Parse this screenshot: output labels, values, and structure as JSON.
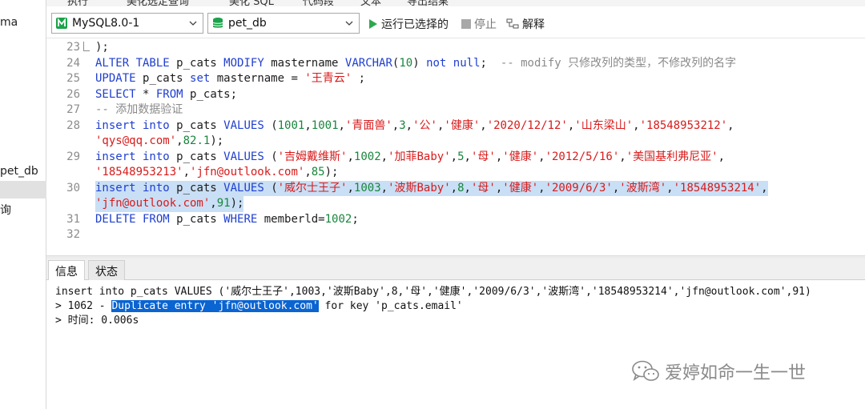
{
  "top_strip": [
    "执行",
    "美化选定查询",
    "美化 SQL",
    "代码段",
    "文本",
    "导出结果"
  ],
  "navigator": {
    "items": [
      "ma",
      "pet_db",
      "询"
    ]
  },
  "toolbar": {
    "connection": "MySQL8.0-1",
    "database": "pet_db",
    "run_selected": "运行已选择的",
    "stop": "停止",
    "explain": "解释",
    "colors": {
      "connection_icon": "#1aa34a",
      "database_icon": "#1aa34a",
      "run_icon": "#2fa84f"
    }
  },
  "editor": {
    "lines": [
      {
        "no": "23",
        "tokens": [
          {
            "t": "p",
            "v": ");"
          }
        ]
      },
      {
        "no": "24",
        "tokens": [
          {
            "t": "k",
            "v": "ALTER TABLE "
          },
          {
            "t": "p",
            "v": "p_cats "
          },
          {
            "t": "k",
            "v": "MODIFY "
          },
          {
            "t": "p",
            "v": "mastername "
          },
          {
            "t": "k",
            "v": "VARCHAR"
          },
          {
            "t": "p",
            "v": "("
          },
          {
            "t": "n",
            "v": "10"
          },
          {
            "t": "p",
            "v": ") "
          },
          {
            "t": "k",
            "v": "not null"
          },
          {
            "t": "p",
            "v": ";  "
          },
          {
            "t": "c",
            "v": "-- modify 只修改列的类型，不修改列的名字"
          }
        ]
      },
      {
        "no": "25",
        "tokens": [
          {
            "t": "k",
            "v": "UPDATE "
          },
          {
            "t": "p",
            "v": "p_cats "
          },
          {
            "t": "k",
            "v": "set "
          },
          {
            "t": "p",
            "v": "mastername = "
          },
          {
            "t": "s",
            "v": "'王青云'"
          },
          {
            "t": "p",
            "v": " ;"
          }
        ]
      },
      {
        "no": "26",
        "tokens": [
          {
            "t": "k",
            "v": "SELECT "
          },
          {
            "t": "p",
            "v": "* "
          },
          {
            "t": "k",
            "v": "FROM "
          },
          {
            "t": "p",
            "v": "p_cats;"
          }
        ]
      },
      {
        "no": "27",
        "tokens": [
          {
            "t": "c",
            "v": "-- 添加数据验证"
          }
        ]
      },
      {
        "no": "28",
        "tokens": [
          {
            "t": "k",
            "v": "insert into "
          },
          {
            "t": "p",
            "v": "p_cats "
          },
          {
            "t": "k",
            "v": "VALUES "
          },
          {
            "t": "p",
            "v": "("
          },
          {
            "t": "n",
            "v": "1001"
          },
          {
            "t": "p",
            "v": ","
          },
          {
            "t": "n",
            "v": "1001"
          },
          {
            "t": "p",
            "v": ","
          },
          {
            "t": "s",
            "v": "'青面兽'"
          },
          {
            "t": "p",
            "v": ","
          },
          {
            "t": "n",
            "v": "3"
          },
          {
            "t": "p",
            "v": ","
          },
          {
            "t": "s",
            "v": "'公'"
          },
          {
            "t": "p",
            "v": ","
          },
          {
            "t": "s",
            "v": "'健康'"
          },
          {
            "t": "p",
            "v": ","
          },
          {
            "t": "s",
            "v": "'2020/12/12'"
          },
          {
            "t": "p",
            "v": ","
          },
          {
            "t": "s",
            "v": "'山东梁山'"
          },
          {
            "t": "p",
            "v": ","
          },
          {
            "t": "s",
            "v": "'18548953212'"
          },
          {
            "t": "p",
            "v": ","
          }
        ]
      },
      {
        "no": "",
        "tokens": [
          {
            "t": "s",
            "v": "'qys@qq.com'"
          },
          {
            "t": "p",
            "v": ","
          },
          {
            "t": "n",
            "v": "82.1"
          },
          {
            "t": "p",
            "v": ");"
          }
        ]
      },
      {
        "no": "29",
        "tokens": [
          {
            "t": "k",
            "v": "insert into "
          },
          {
            "t": "p",
            "v": "p_cats "
          },
          {
            "t": "k",
            "v": "VALUES "
          },
          {
            "t": "p",
            "v": "("
          },
          {
            "t": "s",
            "v": "'吉姆戴维斯'"
          },
          {
            "t": "p",
            "v": ","
          },
          {
            "t": "n",
            "v": "1002"
          },
          {
            "t": "p",
            "v": ","
          },
          {
            "t": "s",
            "v": "'加菲Baby'"
          },
          {
            "t": "p",
            "v": ","
          },
          {
            "t": "n",
            "v": "5"
          },
          {
            "t": "p",
            "v": ","
          },
          {
            "t": "s",
            "v": "'母'"
          },
          {
            "t": "p",
            "v": ","
          },
          {
            "t": "s",
            "v": "'健康'"
          },
          {
            "t": "p",
            "v": ","
          },
          {
            "t": "s",
            "v": "'2012/5/16'"
          },
          {
            "t": "p",
            "v": ","
          },
          {
            "t": "s",
            "v": "'美国基利弗尼亚'"
          },
          {
            "t": "p",
            "v": ","
          }
        ]
      },
      {
        "no": "",
        "tokens": [
          {
            "t": "s",
            "v": "'18548953213'"
          },
          {
            "t": "p",
            "v": ","
          },
          {
            "t": "s",
            "v": "'jfn@outlook.com'"
          },
          {
            "t": "p",
            "v": ","
          },
          {
            "t": "n",
            "v": "85"
          },
          {
            "t": "p",
            "v": ");"
          }
        ]
      },
      {
        "no": "30",
        "hl": true,
        "tokens": [
          {
            "t": "k",
            "v": "insert into "
          },
          {
            "t": "p",
            "v": "p_cats "
          },
          {
            "t": "k",
            "v": "VALUES "
          },
          {
            "t": "p",
            "v": "("
          },
          {
            "t": "s",
            "v": "'威尔士王子'"
          },
          {
            "t": "p",
            "v": ","
          },
          {
            "t": "n",
            "v": "1003"
          },
          {
            "t": "p",
            "v": ","
          },
          {
            "t": "s",
            "v": "'波斯Baby'"
          },
          {
            "t": "p",
            "v": ","
          },
          {
            "t": "n",
            "v": "8"
          },
          {
            "t": "p",
            "v": ","
          },
          {
            "t": "s",
            "v": "'母'"
          },
          {
            "t": "p",
            "v": ","
          },
          {
            "t": "s",
            "v": "'健康'"
          },
          {
            "t": "p",
            "v": ","
          },
          {
            "t": "s",
            "v": "'2009/6/3'"
          },
          {
            "t": "p",
            "v": ","
          },
          {
            "t": "s",
            "v": "'波斯湾'"
          },
          {
            "t": "p",
            "v": ","
          },
          {
            "t": "s",
            "v": "'18548953214'"
          },
          {
            "t": "p",
            "v": ","
          }
        ]
      },
      {
        "no": "",
        "hl": true,
        "tokens": [
          {
            "t": "s",
            "v": "'jfn@outlook.com'"
          },
          {
            "t": "p",
            "v": ","
          },
          {
            "t": "n",
            "v": "91"
          },
          {
            "t": "p",
            "v": ");"
          }
        ]
      },
      {
        "no": "31",
        "tokens": [
          {
            "t": "k",
            "v": "DELETE FROM "
          },
          {
            "t": "p",
            "v": "p_cats "
          },
          {
            "t": "k",
            "v": "WHERE "
          },
          {
            "t": "p",
            "v": "memberld="
          },
          {
            "t": "n",
            "v": "1002"
          },
          {
            "t": "p",
            "v": ";"
          }
        ]
      },
      {
        "no": "32",
        "tokens": []
      }
    ]
  },
  "bottom_tabs": [
    "信息",
    "状态"
  ],
  "output": {
    "line1": "insert into p_cats VALUES ('威尔士王子',1003,'波斯Baby',8,'母','健康','2009/6/3','波斯湾','18548953214','jfn@outlook.com',91)",
    "line2_prefix": "> 1062 - ",
    "line2_selected": "Duplicate entry 'jfn@outlook.com'",
    "line2_suffix": " for key 'p_cats.email'",
    "line3": "> 时间: 0.006s"
  },
  "watermark": {
    "text": "爱婷如命一生一世",
    "icon": "wechat-icon"
  }
}
